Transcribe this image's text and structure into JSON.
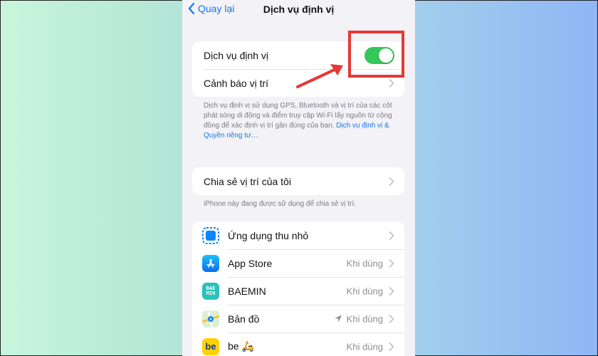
{
  "navbar": {
    "back_label": "Quay lại",
    "title": "Dịch vụ định vị"
  },
  "location_services": {
    "toggle_label": "Dịch vụ định vị",
    "toggle_state": "on",
    "alerts_label": "Cảnh báo vị trí",
    "footnote": "Dịch vụ định vị sử dụng GPS, Bluetooth và vị trí của các cột phát sóng di động và điểm truy cập Wi-Fi lấy nguồn từ cộng đồng để xác định vị trí gần đúng của bạn.",
    "footnote_link": "Dịch vụ định vị & Quyền riêng tư…"
  },
  "share": {
    "label": "Chia sẻ vị trí của tôi",
    "footnote": "iPhone này đang được sử dụng để chia sẻ vị trí."
  },
  "apps": [
    {
      "name": "Ứng dụng thu nhỏ",
      "value": "",
      "icon": "app-clip-icon"
    },
    {
      "name": "App Store",
      "value": "Khi dùng",
      "icon": "app-store-icon"
    },
    {
      "name": "BAEMIN",
      "value": "Khi dùng",
      "icon": "baemin-icon",
      "icon_text": "BAE MIN"
    },
    {
      "name": "Bản đồ",
      "value": "Khi dùng",
      "icon": "maps-icon"
    },
    {
      "name": "be 🛵",
      "value": "Khi dùng",
      "icon": "be-icon",
      "icon_text": "be"
    }
  ],
  "colors": {
    "accent": "#1a73e8",
    "toggle_on": "#34c759",
    "highlight": "#e53935",
    "baemin": "#2ac1bc",
    "be": "#ffd200"
  }
}
